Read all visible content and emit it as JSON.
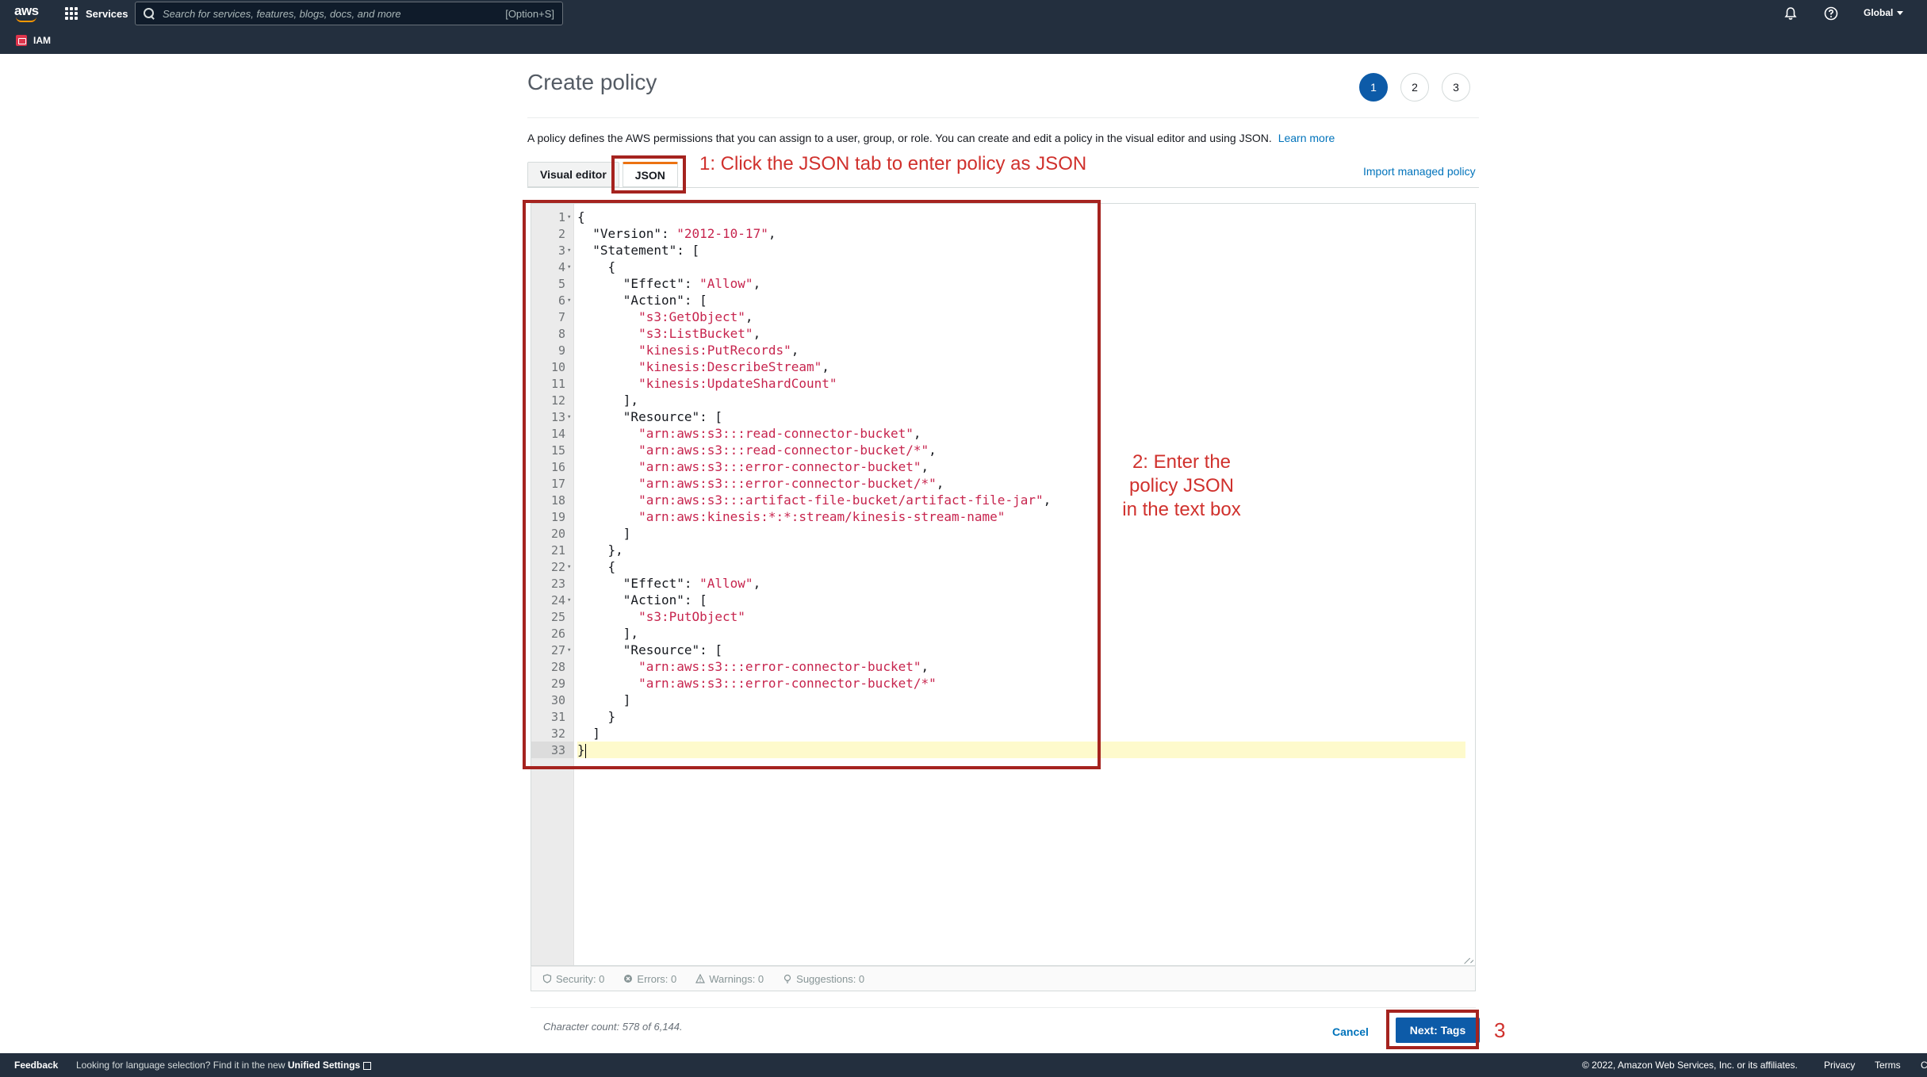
{
  "nav": {
    "logo_text": "aws",
    "services_label": "Services",
    "search_placeholder": "Search for services, features, blogs, docs, and more",
    "search_shortcut": "[Option+S]",
    "region_label": "Global",
    "service_name": "IAM",
    "accent_color": "#ff9900"
  },
  "page": {
    "title": "Create policy",
    "steps": [
      "1",
      "2",
      "3"
    ],
    "active_step": "1",
    "description": "A policy defines the AWS permissions that you can assign to a user, group, or role. You can create and edit a policy in the visual editor and using JSON.",
    "learn_more": "Learn more",
    "import_link": "Import managed policy"
  },
  "tabs": [
    {
      "label": "Visual editor",
      "active": false
    },
    {
      "label": "JSON",
      "active": true
    }
  ],
  "editor": {
    "active_line": 33,
    "lines": [
      "{",
      "  \"Version\": \"2012-10-17\",",
      "  \"Statement\": [",
      "    {",
      "      \"Effect\": \"Allow\",",
      "      \"Action\": [",
      "        \"s3:GetObject\",",
      "        \"s3:ListBucket\",",
      "        \"kinesis:PutRecords\",",
      "        \"kinesis:DescribeStream\",",
      "        \"kinesis:UpdateShardCount\"",
      "      ],",
      "      \"Resource\": [",
      "        \"arn:aws:s3:::read-connector-bucket\",",
      "        \"arn:aws:s3:::read-connector-bucket/*\",",
      "        \"arn:aws:s3:::error-connector-bucket\",",
      "        \"arn:aws:s3:::error-connector-bucket/*\",",
      "        \"arn:aws:s3:::artifact-file-bucket/artifact-file-jar\",",
      "        \"arn:aws:kinesis:*:*:stream/kinesis-stream-name\"",
      "      ]",
      "    },",
      "    {",
      "      \"Effect\": \"Allow\",",
      "      \"Action\": [",
      "        \"s3:PutObject\"",
      "      ],",
      "      \"Resource\": [",
      "        \"arn:aws:s3:::error-connector-bucket\",",
      "        \"arn:aws:s3:::error-connector-bucket/*\"",
      "      ]",
      "    }",
      "  ]",
      "}"
    ],
    "fold_lines": [
      1,
      3,
      4,
      6,
      13,
      22,
      24,
      27
    ]
  },
  "status": {
    "security": "Security: 0",
    "errors": "Errors: 0",
    "warnings": "Warnings: 0",
    "suggestions": "Suggestions: 0"
  },
  "actions": {
    "char_count": "Character count: 578 of 6,144.",
    "cancel": "Cancel",
    "next": "Next: Tags"
  },
  "annotations": {
    "step1": "1: Click the JSON tab to enter policy as JSON",
    "step2_line1": "2: Enter the",
    "step2_line2": "policy JSON",
    "step2_line3": "in the text box",
    "step3": "3",
    "color": "#d0312d"
  },
  "footer": {
    "feedback": "Feedback",
    "language_msg": "Looking for language selection? Find it in the new",
    "unified_settings": "Unified Settings",
    "copyright": "© 2022, Amazon Web Services, Inc. or its affiliates.",
    "privacy": "Privacy",
    "terms": "Terms",
    "cookie": "C"
  }
}
